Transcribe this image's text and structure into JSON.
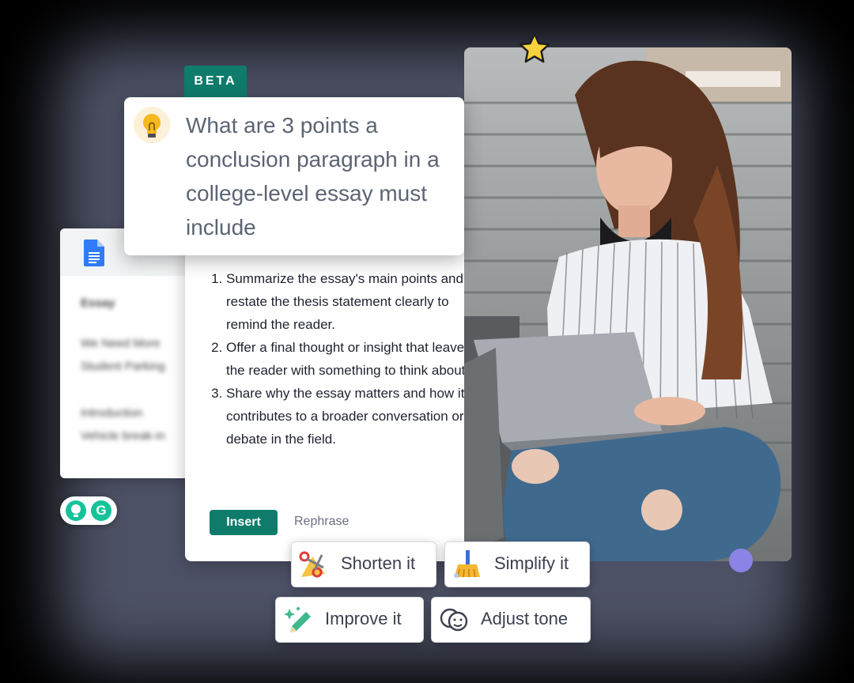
{
  "beta_tag": "BETA",
  "question": "What are 3 points a conclusion paragraph in a college-level essay must include",
  "answer": {
    "points": [
      "Summarize the essay's main points and restate the thesis statement clearly to remind the reader.",
      "Offer a final thought or insight that leaves the reader with something to think about.",
      "Share why the essay matters and how it contributes to a broader conversation or debate in the field."
    ],
    "insert_label": "Insert",
    "rephrase_label": "Rephrase"
  },
  "doc": {
    "title": "Essay",
    "lines": [
      "We Need More",
      "Student Parking",
      "Introduction",
      "Vehicle break-in"
    ]
  },
  "actions": {
    "shorten": "Shorten it",
    "simplify": "Simplify it",
    "improve": "Improve it",
    "adjust_tone": "Adjust tone"
  },
  "colors": {
    "brand_green": "#0f7c6b",
    "accent_purple": "#8b83e6",
    "star_yellow": "#f7d23c"
  }
}
